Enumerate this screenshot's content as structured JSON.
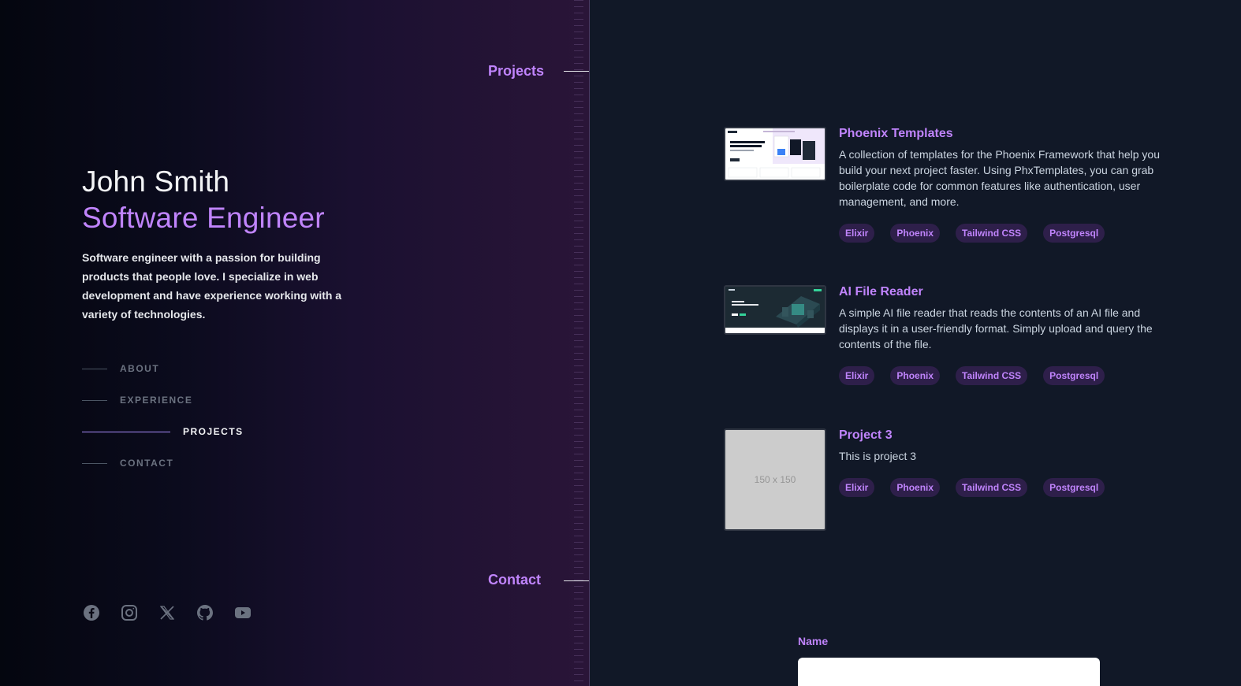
{
  "sections": {
    "projects_label": "Projects",
    "contact_label": "Contact"
  },
  "profile": {
    "name": "John Smith",
    "role": "Software Engineer",
    "bio": "Software engineer with a passion for building products that people love. I specialize in web development and have experience working with a variety of technologies."
  },
  "nav": {
    "items": [
      {
        "label": "ABOUT",
        "active": false
      },
      {
        "label": "EXPERIENCE",
        "active": false
      },
      {
        "label": "PROJECTS",
        "active": true
      },
      {
        "label": "CONTACT",
        "active": false
      }
    ]
  },
  "socials": [
    "facebook-icon",
    "instagram-icon",
    "x-icon",
    "github-icon",
    "youtube-icon"
  ],
  "projects": [
    {
      "title": "Phoenix Templates",
      "description": "A collection of templates for the Phoenix Framework that help you build your next project faster. Using PhxTemplates, you can grab boilerplate code for common features like authentication, user management, and more.",
      "tags": [
        "Elixir",
        "Phoenix",
        "Tailwind CSS",
        "Postgresql"
      ]
    },
    {
      "title": "AI File Reader",
      "description": "A simple AI file reader that reads the contents of an AI file and displays it in a user-friendly format. Simply upload and query the contents of the file.",
      "tags": [
        "Elixir",
        "Phoenix",
        "Tailwind CSS",
        "Postgresql"
      ]
    },
    {
      "title": "Project 3",
      "description": "This is project 3",
      "tags": [
        "Elixir",
        "Phoenix",
        "Tailwind CSS",
        "Postgresql"
      ],
      "thumbnail_text": "150 x 150"
    }
  ],
  "contact_form": {
    "name_label": "Name",
    "name_value": ""
  },
  "colors": {
    "accent": "#c084fc",
    "page_bg": "#111827",
    "tag_bg": "#2e1f4a"
  }
}
